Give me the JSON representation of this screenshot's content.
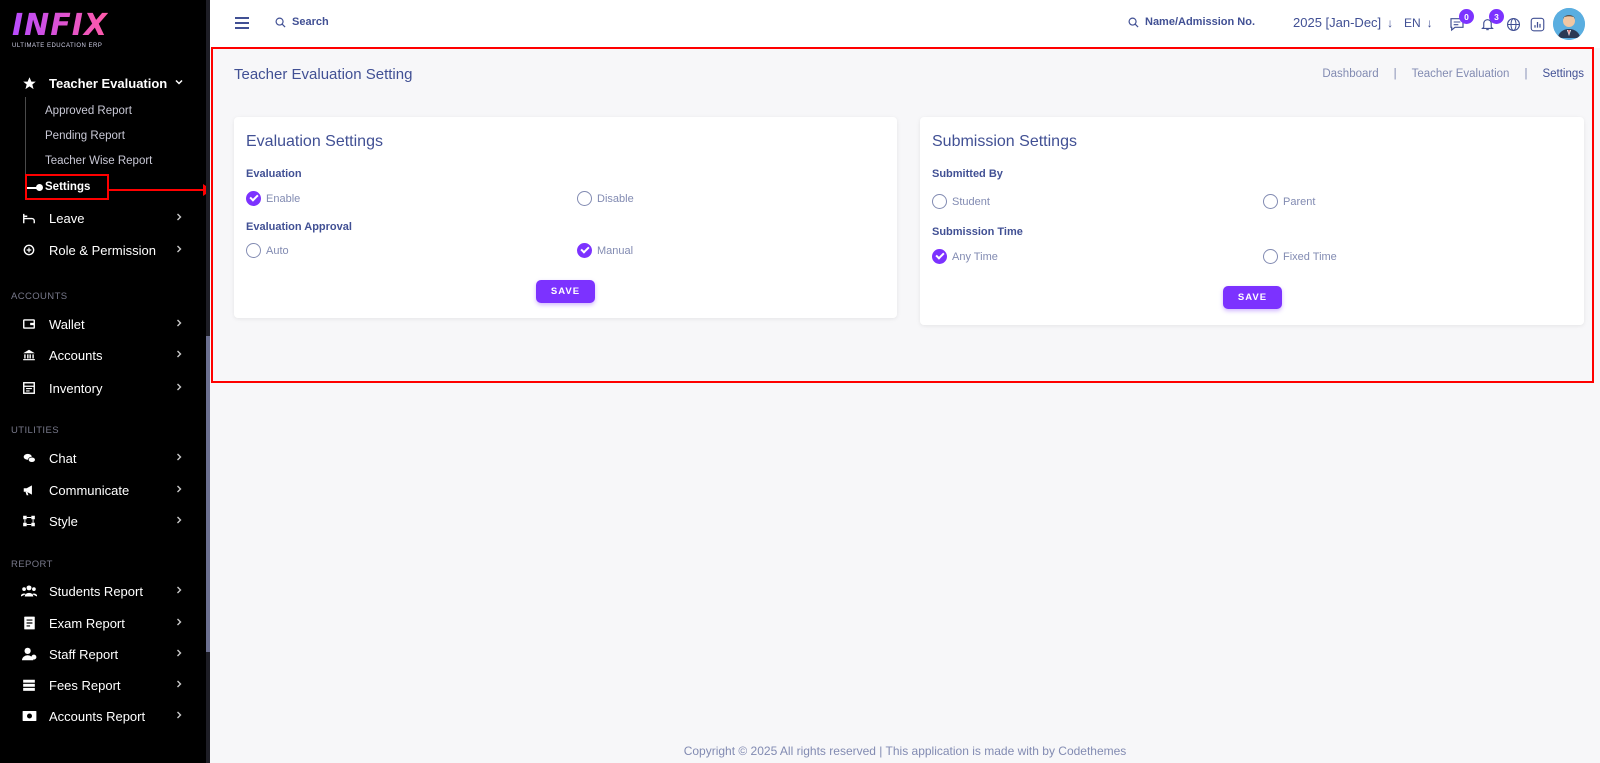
{
  "logo": {
    "word": "INFIX",
    "tagline": "ULTIMATE EDUCATION ERP"
  },
  "sidebar": {
    "teacher_eval": {
      "label": "Teacher Evaluation",
      "subitems": [
        "Approved Report",
        "Pending Report",
        "Teacher Wise Report",
        "Settings"
      ]
    },
    "items_top": [
      {
        "label": "Leave",
        "icon": "leave-icon"
      },
      {
        "label": "Role & Permission",
        "icon": "role-icon"
      }
    ],
    "section_accounts": "ACCOUNTS",
    "accounts_items": [
      {
        "label": "Wallet",
        "icon": "wallet-icon"
      },
      {
        "label": "Accounts",
        "icon": "bank-icon"
      },
      {
        "label": "Inventory",
        "icon": "inventory-icon"
      }
    ],
    "section_utilities": "UTILITIES",
    "utilities_items": [
      {
        "label": "Chat",
        "icon": "chat-icon"
      },
      {
        "label": "Communicate",
        "icon": "megaphone-icon"
      },
      {
        "label": "Style",
        "icon": "style-icon"
      }
    ],
    "section_report": "REPORT",
    "report_items": [
      {
        "label": "Students Report",
        "icon": "students-icon"
      },
      {
        "label": "Exam Report",
        "icon": "exam-icon"
      },
      {
        "label": "Staff Report",
        "icon": "staff-icon"
      },
      {
        "label": "Fees Report",
        "icon": "fees-icon"
      },
      {
        "label": "Accounts Report",
        "icon": "accounts-report-icon"
      }
    ]
  },
  "header": {
    "search_placeholder": "Search",
    "admission_search": "Name/Admission No.",
    "year": "2025 [Jan-Dec]",
    "lang": "EN",
    "messages_count": "0",
    "notifications_count": "3"
  },
  "page": {
    "title": "Teacher Evaluation Setting",
    "breadcrumb": [
      "Dashboard",
      "Teacher Evaluation",
      "Settings"
    ]
  },
  "evaluation_card": {
    "title": "Evaluation Settings",
    "evaluation_label": "Evaluation",
    "enable": "Enable",
    "disable": "Disable",
    "approval_label": "Evaluation Approval",
    "auto": "Auto",
    "manual": "Manual",
    "save": "SAVE",
    "evaluation_selected": "Enable",
    "approval_selected": "Manual"
  },
  "submission_card": {
    "title": "Submission Settings",
    "submitted_by_label": "Submitted By",
    "student": "Student",
    "parent": "Parent",
    "time_label": "Submission Time",
    "any_time": "Any Time",
    "fixed_time": "Fixed Time",
    "save": "SAVE",
    "time_selected": "Any Time"
  },
  "footer": "Copyright © 2025 All rights reserved | This application is made with by Codethemes",
  "colors": {
    "accent": "#7c32ff",
    "text_primary": "#415094",
    "text_muted": "#828bb2",
    "annotation": "#ff0000"
  }
}
